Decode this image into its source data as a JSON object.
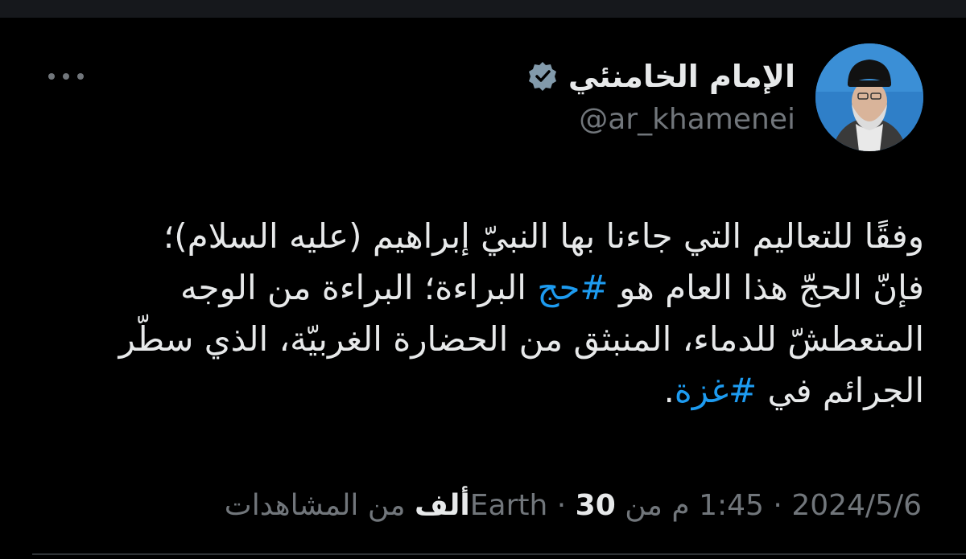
{
  "author": {
    "display_name": "الإمام الخامنئي",
    "handle": "@ar_khamenei",
    "verified_icon": "verified-badge-icon",
    "avatar_icon": "profile-avatar"
  },
  "tweet": {
    "lines": [
      {
        "segments": [
          {
            "text": "وفقًا للتعاليم التي جاءنا بها النبيّ إبراهيم (عليه السلام)؛",
            "hashtag": false
          }
        ]
      },
      {
        "segments": [
          {
            "text": "فإنّ الحجّ هذا العام هو ",
            "hashtag": false
          },
          {
            "text": "#حج",
            "hashtag": true
          },
          {
            "text": " البراءة؛ البراءة من الوجه",
            "hashtag": false
          }
        ]
      },
      {
        "segments": [
          {
            "text": "المتعطشّ للدماء، المنبثق من الحضارة الغربيّة، الذي سطّر",
            "hashtag": false
          }
        ]
      },
      {
        "segments": [
          {
            "text": "الجرائم في ",
            "hashtag": false
          },
          {
            "text": "#غزة",
            "hashtag": true
          },
          {
            "text": ".",
            "hashtag": false
          }
        ]
      }
    ]
  },
  "meta": {
    "date": "2024/5/6",
    "time": "1:45 م",
    "from": "من",
    "location": "Earth",
    "views_count": "30ألف",
    "views_label": "من المشاهدات",
    "separator": "·"
  },
  "colors": {
    "background": "#000000",
    "text": "#e7e9ea",
    "secondary": "#71767b",
    "link": "#1d9bf0"
  },
  "more_icon": "more-horizontal-icon"
}
